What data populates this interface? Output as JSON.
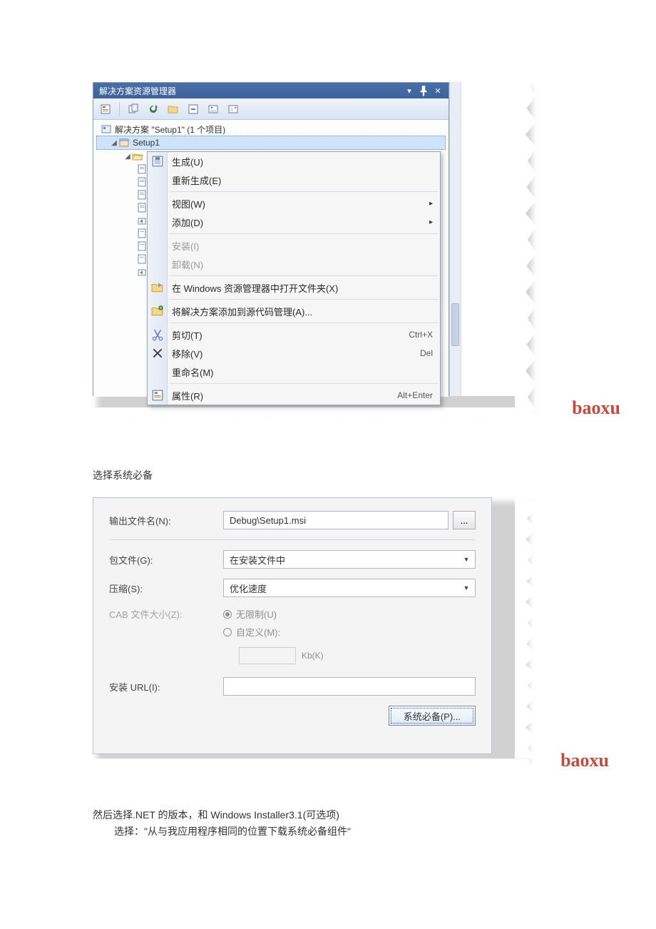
{
  "explorer": {
    "title": "解决方案资源管理器",
    "solution_label": "解决方案 \"Setup1\" (1 个项目)",
    "project_name": "Setup1"
  },
  "context_menu": {
    "build": "生成(U)",
    "rebuild": "重新生成(E)",
    "view": "视图(W)",
    "add": "添加(D)",
    "install": "安装(I)",
    "uninstall": "卸载(N)",
    "open_in_explorer": "在 Windows 资源管理器中打开文件夹(X)",
    "add_source_control": "将解决方案添加到源代码管理(A)...",
    "cut": "剪切(T)",
    "cut_shortcut": "Ctrl+X",
    "remove": "移除(V)",
    "remove_shortcut": "Del",
    "rename": "重命名(M)",
    "properties": "属性(R)",
    "properties_shortcut": "Alt+Enter"
  },
  "body": {
    "para1": "选择系统必备",
    "para2a": "然后选择.NET 的版本，和 Windows Installer3.1(可选项)",
    "para2b": "选择：\"从与我应用程序相同的位置下载系统必备组件\""
  },
  "propform": {
    "output_name_label": "输出文件名(N):",
    "output_name_value": "Debug\\Setup1.msi",
    "package_label": "包文件(G):",
    "package_value": "在安装文件中",
    "compress_label": "压缩(S):",
    "compress_value": "优化速度",
    "cab_label": "CAB 文件大小(Z):",
    "radio_unlimited": "无限制(U)",
    "radio_custom": "自定义(M):",
    "kb_label": "Kb(K)",
    "url_label": "安装 URL(I):",
    "prereq_button": "系统必备(P)..."
  },
  "watermark": "baoxu"
}
